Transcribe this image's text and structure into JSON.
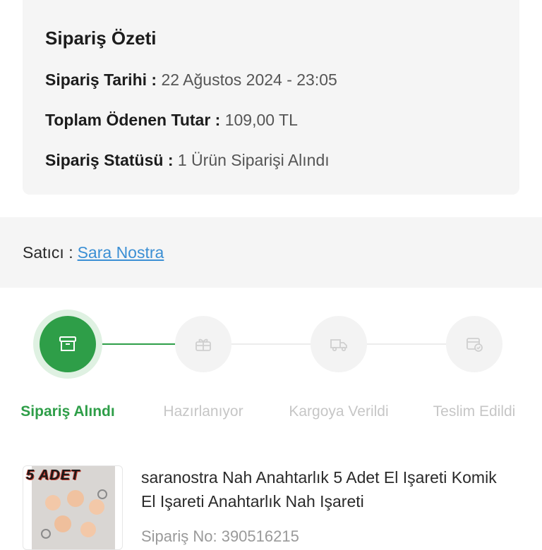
{
  "summary": {
    "title": "Sipariş Özeti",
    "date_label": "Sipariş Tarihi :",
    "date_value": "22 Ağustos 2024 - 23:05",
    "total_label": "Toplam Ödenen Tutar :",
    "total_value": "109,00 TL",
    "status_label": "Sipariş Statüsü :",
    "status_value": "1 Ürün Siparişi Alındı"
  },
  "seller": {
    "label": "Satıcı :",
    "name": "Sara Nostra"
  },
  "tracking": {
    "steps": [
      {
        "label": "Sipariş Alındı",
        "icon": "box-icon",
        "active": true
      },
      {
        "label": "Hazırlanıyor",
        "icon": "gift-icon",
        "active": false
      },
      {
        "label": "Kargoya Verildi",
        "icon": "delivery-truck-icon",
        "active": false
      },
      {
        "label": "Teslim Edildi",
        "icon": "delivered-check-icon",
        "active": false
      }
    ],
    "colors": {
      "active": "#2e9e48",
      "inactive": "#c6c6c6",
      "link": "#3b8fd4"
    }
  },
  "product": {
    "image_text": "5 ADET",
    "title": "saranostra Nah Anahtarlık 5 Adet El Işareti Komik El Işareti Anahtarlık Nah Işareti",
    "order_no": "Sipariş No: 390516215"
  }
}
